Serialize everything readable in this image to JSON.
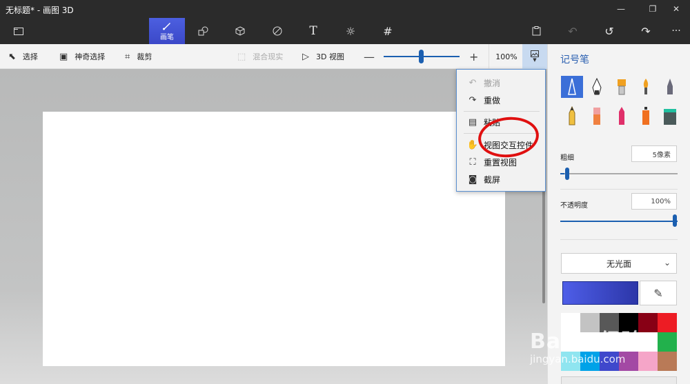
{
  "window": {
    "title": "无标题* - 画图 3D",
    "controls": [
      "—",
      "❐",
      "✕"
    ]
  },
  "main_toolbar": {
    "active_label": "画笔",
    "icons": [
      "folder-icon",
      "brush-icon",
      "shapes-2d-icon",
      "cube-icon",
      "sticker-icon",
      "text-icon",
      "effects-icon",
      "crop-icon",
      "paste-icon",
      "undo-icon",
      "history-icon",
      "redo-icon",
      "more-icon"
    ]
  },
  "sub_toolbar": {
    "select": "选择",
    "magic_select": "神奇选择",
    "crop": "裁剪",
    "mixed_reality": "混合现实",
    "view_3d": "3D 视图",
    "zoom_minus": "—",
    "zoom_plus": "+",
    "zoom_percent": "100%",
    "zoom_level": 0.45
  },
  "view_menu": {
    "items": [
      {
        "label": "撤消",
        "disabled": true
      },
      {
        "label": "重做",
        "disabled": false
      },
      {
        "label": "粘贴",
        "disabled": false
      },
      {
        "label": "视图交互控件",
        "disabled": false
      },
      {
        "label": "重置视图",
        "disabled": false
      },
      {
        "label": "截屏",
        "disabled": false
      }
    ]
  },
  "panel": {
    "title": "记号笔",
    "thickness_label": "粗细",
    "thickness_value": "5像素",
    "thickness_level": 0.03,
    "opacity_label": "不透明度",
    "opacity_value": "100%",
    "opacity_level": 1.0,
    "finish": "无光面",
    "current_color": "#3f49c8",
    "swatches": [
      "#ffffff",
      "#c3c3c3",
      "#585858",
      "#000000",
      "#880015",
      "#ed1c24",
      "#ffffff",
      "#ffffff",
      "#ffffff",
      "#ffffff",
      "#ffffff",
      "#22b14c",
      "#8fe5f0",
      "#00a2e8",
      "#3f48cc",
      "#a349a4",
      "#f5a5c8",
      "#b97a57"
    ]
  },
  "watermark": {
    "text": "Baidu经验",
    "sub": "jingyan.baidu.com"
  }
}
